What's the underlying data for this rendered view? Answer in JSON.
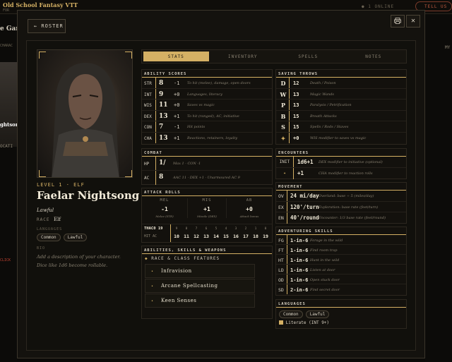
{
  "app": {
    "title": "Old School Fantasy VTT",
    "subtitle": "FOR",
    "online": "1 ONLINE",
    "tell_us": "TELL US"
  },
  "background": {
    "game_title": "e Gam",
    "charac_label": "CHARAC",
    "name_fragment": "ghtsong",
    "cat_label": "OCATI",
    "click_label": "CLICK",
    "my_label": "MY"
  },
  "toolbar": {
    "roster_label": "← ROSTER",
    "print_icon": "printer-icon",
    "close_label": "✕"
  },
  "character": {
    "level_class": "LEVEL 1 · ELF",
    "name": "Faelar Nightsong",
    "alignment": "Lawful",
    "race_label": "RACE",
    "race": "Elf",
    "languages_label": "LANGUAGES",
    "languages": [
      "Common",
      "Lawful"
    ],
    "bio_label": "BIO",
    "bio_placeholder": "Add a description of your character. Dice like 1d6 become rollable."
  },
  "tabs": [
    {
      "label": "STATS",
      "active": true
    },
    {
      "label": "INVENTORY"
    },
    {
      "label": "SPELLS"
    },
    {
      "label": "NOTES"
    }
  ],
  "ability_scores": {
    "title": "ABILITY SCORES",
    "rows": [
      {
        "code": "STR",
        "score": "8",
        "mod": "-1",
        "desc": "To hit (melee), damage, open doors"
      },
      {
        "code": "INT",
        "score": "9",
        "mod": "+0",
        "desc": "Languages, literacy"
      },
      {
        "code": "WIS",
        "score": "11",
        "mod": "+0",
        "desc": "Saves vs magic"
      },
      {
        "code": "DEX",
        "score": "13",
        "mod": "+1",
        "desc": "To hit (ranged), AC, initiative"
      },
      {
        "code": "CON",
        "score": "7",
        "mod": "-1",
        "desc": "Hit points"
      },
      {
        "code": "CHA",
        "score": "13",
        "mod": "+1",
        "desc": "Reactions, retainers, loyalty"
      }
    ]
  },
  "saving_throws": {
    "title": "SAVING THROWS",
    "rows": [
      {
        "code": "D",
        "value": "12",
        "desc": "Death / Poison"
      },
      {
        "code": "W",
        "value": "13",
        "desc": "Magic Wands"
      },
      {
        "code": "P",
        "value": "13",
        "desc": "Paralysis / Petrification"
      },
      {
        "code": "B",
        "value": "15",
        "desc": "Breath Attacks"
      },
      {
        "code": "S",
        "value": "15",
        "desc": "Spells / Rods / Staves"
      },
      {
        "code": "✦",
        "value": "+0",
        "desc": "WIS modifier to saves vs magic"
      }
    ]
  },
  "combat": {
    "title": "COMBAT",
    "rows": [
      {
        "code": "HP",
        "value": "1/",
        "desc": "Max 1 · CON -1"
      },
      {
        "code": "AC",
        "value": "8",
        "desc": "AAC 11 · DEX +1 · Unarmoured AC 9"
      }
    ]
  },
  "encounters": {
    "title": "ENCOUNTERS",
    "rows": [
      {
        "code": "INIT",
        "value": "1d6+1",
        "desc": "DEX modifier to initiative (optional)"
      },
      {
        "code": "✦",
        "value": "+1",
        "desc": "CHA modifier to reaction rolls"
      }
    ]
  },
  "movement": {
    "title": "MOVEMENT",
    "rows": [
      {
        "code": "OV",
        "value": "24 mi/day",
        "desc": "Overland: base ÷ 5 (miles/day)"
      },
      {
        "code": "EX",
        "value": "120'/turn",
        "desc": "Exploration: base rate (feet/turn)"
      },
      {
        "code": "EN",
        "value": "40'/round",
        "desc": "Encounter: 1/3 base rate (feet/round)"
      }
    ]
  },
  "attack_rolls": {
    "title": "ATTACK ROLLS",
    "cells": [
      {
        "label": "MEL",
        "value": "-1",
        "sub": "Melee (STR)"
      },
      {
        "label": "MIS",
        "value": "+1",
        "sub": "Missile (DEX)"
      },
      {
        "label": "AB",
        "value": "+0",
        "sub": "Attack bonus"
      }
    ],
    "thaco_label": "THAC0 19",
    "hit_ac_label": "HIT AC",
    "ac_row": [
      "9",
      "8",
      "7",
      "6",
      "5",
      "4",
      "3",
      "2",
      "1",
      "0"
    ],
    "hit_row": [
      "10",
      "11",
      "12",
      "13",
      "14",
      "15",
      "16",
      "17",
      "18",
      "19"
    ]
  },
  "abilities_panel": {
    "title": "ABILITIES, SKILLS & WEAPONS",
    "sub_title": "RACE & CLASS FEATURES",
    "features": [
      "Infravision",
      "Arcane Spellcasting",
      "Keen Senses"
    ]
  },
  "adventuring_skills": {
    "title": "ADVENTURING SKILLS",
    "rows": [
      {
        "code": "FG",
        "value": "1-in-6",
        "desc": "Forage in the wild"
      },
      {
        "code": "FT",
        "value": "1-in-6",
        "desc": "Find room trap"
      },
      {
        "code": "HT",
        "value": "1-in-6",
        "desc": "Hunt in the wild"
      },
      {
        "code": "LD",
        "value": "1-in-6",
        "desc": "Listen at door"
      },
      {
        "code": "OD",
        "value": "1-in-6",
        "desc": "Open stuck door"
      },
      {
        "code": "SD",
        "value": "2-in-6",
        "desc": "Find secret door"
      }
    ]
  },
  "languages_panel": {
    "title": "LANGUAGES",
    "chips": [
      "Common",
      "Lawful"
    ],
    "literate": "Literate (INT 9+)"
  },
  "colors": {
    "accent": "#d4b064",
    "background": "#14120e",
    "text": "#d6cfc0"
  }
}
